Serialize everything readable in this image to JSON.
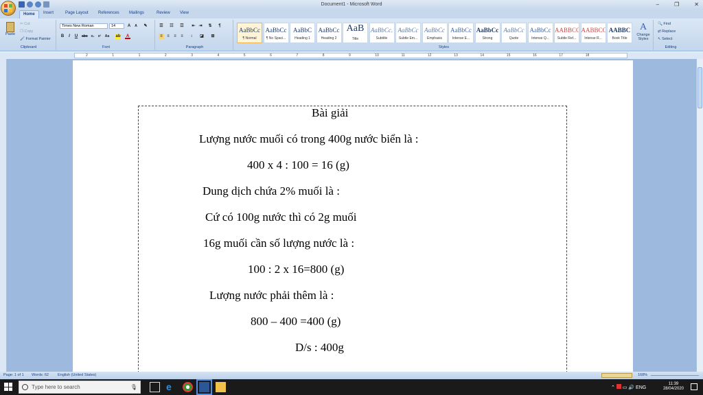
{
  "window": {
    "title": "Document1 - Microsoft Word"
  },
  "tabs": [
    "Home",
    "Insert",
    "Page Layout",
    "References",
    "Mailings",
    "Review",
    "View"
  ],
  "clipboard": {
    "paste": "Paste",
    "cut": "Cut",
    "copy": "Copy",
    "format_painter": "Format Painter",
    "group": "Clipboard"
  },
  "font": {
    "name": "Times New Roman",
    "size": "14",
    "group": "Font"
  },
  "paragraph": {
    "group": "Paragraph"
  },
  "styles": {
    "group": "Styles",
    "items": [
      {
        "sample": "AaBbCc",
        "name": "¶ Normal"
      },
      {
        "sample": "AaBbCc",
        "name": "¶ No Spaci..."
      },
      {
        "sample": "AaBbC",
        "name": "Heading 1"
      },
      {
        "sample": "AaBbCc",
        "name": "Heading 2"
      },
      {
        "sample": "AaB",
        "name": "Title"
      },
      {
        "sample": "AaBbCc.",
        "name": "Subtitle"
      },
      {
        "sample": "AaBbCc",
        "name": "Subtle Em..."
      },
      {
        "sample": "AaBbCc",
        "name": "Emphasis"
      },
      {
        "sample": "AaBbCc",
        "name": "Intense E..."
      },
      {
        "sample": "AaBbCc",
        "name": "Strong"
      },
      {
        "sample": "AaBbCc",
        "name": "Quote"
      },
      {
        "sample": "AaBbCc",
        "name": "Intense Q..."
      },
      {
        "sample": "AABBCC",
        "name": "Subtle Ref..."
      },
      {
        "sample": "AABBCC",
        "name": "Intense R..."
      },
      {
        "sample": "AABBC",
        "name": "Book Title"
      }
    ],
    "change": "Change Styles"
  },
  "editing": {
    "find": "Find",
    "replace": "Replace",
    "select": "Select",
    "group": "Editing"
  },
  "ruler_numbers": [
    "2",
    "1",
    "1",
    "2",
    "3",
    "4",
    "5",
    "6",
    "7",
    "8",
    "9",
    "10",
    "11",
    "12",
    "13",
    "14",
    "15",
    "16",
    "17",
    "18"
  ],
  "document": {
    "lines": [
      "Bài giải",
      "Lượng nước muối có trong 400g nước biển là :",
      "400 x 4 : 100 = 16 (g)",
      "Dung dịch chứa 2% muối là :",
      "Cứ có 100g nước thì có 2g muối",
      "16g muối cần số lượng nước là :",
      "100 : 2 x 16=800 (g)",
      "Lượng nước phải thêm là :",
      "800 – 400 =400 (g)",
      "D/s : 400g"
    ]
  },
  "status": {
    "page": "Page: 1 of 1",
    "words": "Words: 62",
    "language": "English (United States)",
    "zoom": "168%"
  },
  "taskbar": {
    "search_placeholder": "Type here to search",
    "lang": "ENG",
    "time": "11:39",
    "date": "28/04/2020"
  }
}
